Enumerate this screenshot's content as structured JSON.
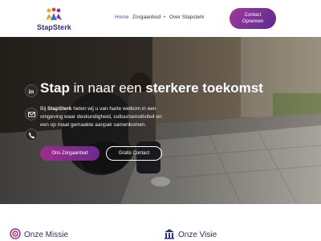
{
  "brand": {
    "name": "StapSterk"
  },
  "nav": {
    "items": [
      {
        "label": "Home"
      },
      {
        "label": "Zorgaanbod",
        "suffix": "+"
      },
      {
        "label": "Over Stapsterk"
      }
    ],
    "contact_button": {
      "line1": "Contact",
      "line2": "Opnemen"
    }
  },
  "hero": {
    "title_part1": "Stap",
    "title_part2": " in naar een ",
    "title_part3": "sterkere toekomst",
    "text_prefix": "Bij ",
    "text_brand": "StapSterk",
    "text_body": " heten wij u van harte welkom in een omgeving waar deskundigheid, cultuursensitiviteit en een op maat gemaakte aanpak samenkomen.",
    "primary_button": "Ons Zorgaanbod",
    "secondary_button": "Gratis Contact"
  },
  "sections": {
    "missie": "Onze Missie",
    "visie": "Onze Visie"
  },
  "colors": {
    "accent_gradient_start": "#a02d8a",
    "accent_gradient_end": "#6a2a90",
    "nav_active": "#4a4ab8",
    "heading": "#2e2e5a"
  },
  "icons": [
    "linkedin-icon",
    "mail-icon",
    "phone-icon",
    "target-icon",
    "building-icon"
  ]
}
